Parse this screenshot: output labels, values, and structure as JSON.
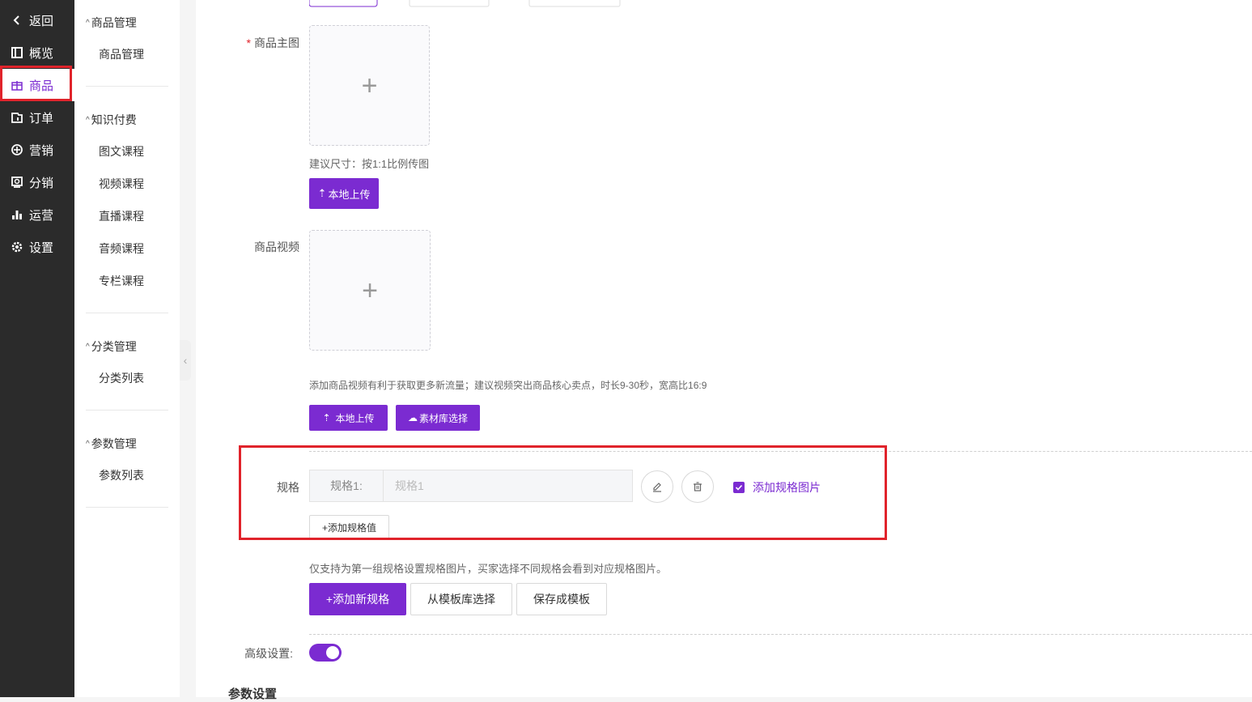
{
  "nav": {
    "items": [
      {
        "label": "返回",
        "icon": "chevron-left-icon"
      },
      {
        "label": "概览",
        "icon": "overview-icon"
      },
      {
        "label": "商品",
        "icon": "gift-icon"
      },
      {
        "label": "订单",
        "icon": "order-icon"
      },
      {
        "label": "营销",
        "icon": "compass-icon"
      },
      {
        "label": "分销",
        "icon": "distribution-icon"
      },
      {
        "label": "运营",
        "icon": "bar-chart-icon"
      },
      {
        "label": "设置",
        "icon": "gear-icon"
      }
    ],
    "active_index": 2,
    "accent_color": "#7b2bd1",
    "highlight_color": "#e0232b"
  },
  "subnav": {
    "groups": [
      {
        "title": "商品管理",
        "items": [
          "商品管理"
        ]
      },
      {
        "title": "知识付费",
        "items": [
          "图文课程",
          "视频课程",
          "直播课程",
          "音频课程",
          "专栏课程"
        ]
      },
      {
        "title": "分类管理",
        "items": [
          "分类列表"
        ]
      },
      {
        "title": "参数管理",
        "items": [
          "参数列表"
        ]
      }
    ]
  },
  "form": {
    "main_image": {
      "label": "商品主图",
      "required": true,
      "hint": "建议尺寸：按1:1比例传图",
      "upload_button": "本地上传"
    },
    "video": {
      "label": "商品视频",
      "hint": "添加商品视频有利于获取更多新流量；建议视频突出商品核心卖点，时长9-30秒，宽高比16:9",
      "upload_button": "本地上传",
      "library_button": "素材库选择"
    },
    "spec": {
      "label": "规格",
      "prefix": "规格1:",
      "placeholder": "规格1",
      "add_image_label": "添加规格图片",
      "add_image_checked": true,
      "add_value_button": "+添加规格值",
      "hint": "仅支持为第一组规格设置规格图片，买家选择不同规格会看到对应规格图片。",
      "add_spec_button": "+添加新规格",
      "from_template_button": "从模板库选择",
      "save_template_button": "保存成模板"
    },
    "advanced": {
      "label": "高级设置:",
      "enabled": true
    },
    "param_section_title": "参数设置"
  }
}
